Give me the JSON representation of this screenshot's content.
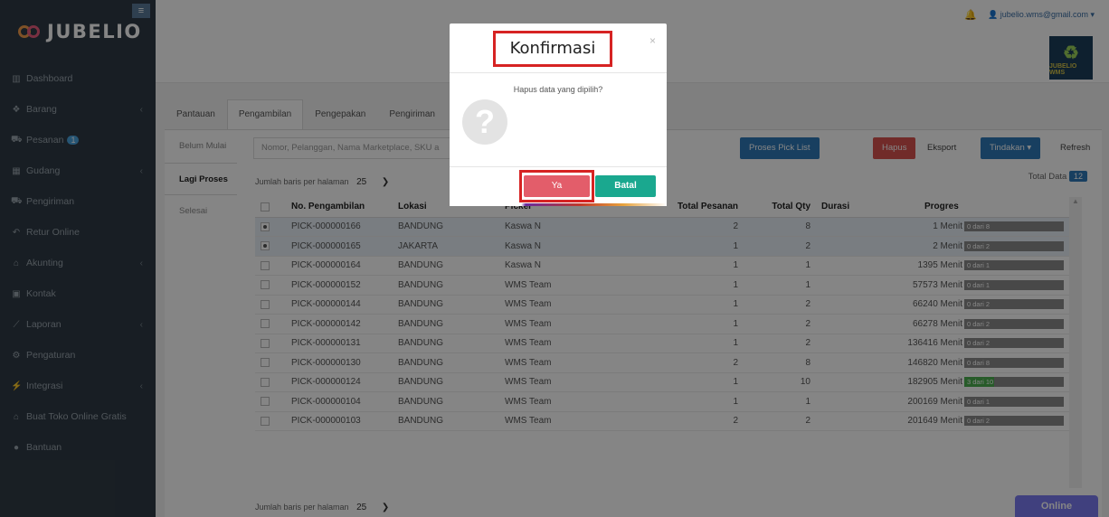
{
  "sidebar": {
    "brand": "JUBELIO",
    "menu_icon": "hamburger-icon",
    "items": [
      {
        "label": "Dashboard",
        "icon": "chart-icon",
        "chevron": false
      },
      {
        "label": "Barang",
        "icon": "box-icon",
        "chevron": true
      },
      {
        "label": "Pesanan",
        "icon": "cart-icon",
        "chevron": false,
        "badge": "1"
      },
      {
        "label": "Gudang",
        "icon": "building-icon",
        "chevron": true
      },
      {
        "label": "Pengiriman",
        "icon": "truck-icon",
        "chevron": false
      },
      {
        "label": "Retur Online",
        "icon": "reply-icon",
        "chevron": false
      },
      {
        "label": "Akunting",
        "icon": "bank-icon",
        "chevron": true
      },
      {
        "label": "Kontak",
        "icon": "id-card-icon",
        "chevron": false
      },
      {
        "label": "Laporan",
        "icon": "line-chart-icon",
        "chevron": true
      },
      {
        "label": "Pengaturan",
        "icon": "gears-icon",
        "chevron": false
      },
      {
        "label": "Integrasi",
        "icon": "plug-icon",
        "chevron": true
      },
      {
        "label": "Buat Toko Online Gratis",
        "icon": "store-icon",
        "chevron": false
      },
      {
        "label": "Bantuan",
        "icon": "help-icon",
        "chevron": false
      }
    ]
  },
  "topbar": {
    "user_email": "jubelio.wms@gmail.com",
    "wms_logo_text": "JUBELIO WMS"
  },
  "tabs": [
    "Pantauan",
    "Pengambilan",
    "Pengepakan",
    "Pengiriman"
  ],
  "active_tab": "Pengambilan",
  "subtabs": [
    "Belum Mulai",
    "Lagi Proses",
    "Selesai"
  ],
  "toolbar": {
    "search_placeholder": "Nomor, Pelanggan, Nama Marketplace, SKU a",
    "proses_pick_list": "Proses Pick List",
    "hapus": "Hapus",
    "eksport": "Eksport",
    "tindakan": "Tindakan ▾",
    "refresh": "Refresh",
    "rows_label": "Jumlah baris per halaman",
    "rows_value": "25",
    "total_label": "Total Data",
    "total_value": "12"
  },
  "table": {
    "headers": [
      "No. Pengambilan",
      "Lokasi",
      "Picker",
      "Total Pesanan",
      "Total Qty",
      "Durasi",
      "Progres"
    ],
    "rows": [
      {
        "no": "PICK-000000166",
        "lokasi": "BANDUNG",
        "picker": "Kaswa N",
        "pesanan": "2",
        "qty": "8",
        "durasi": "1 Menit",
        "progress_text": "0 dari 8",
        "progress": 0,
        "checked": true
      },
      {
        "no": "PICK-000000165",
        "lokasi": "JAKARTA",
        "picker": "Kaswa N",
        "pesanan": "1",
        "qty": "2",
        "durasi": "2 Menit",
        "progress_text": "0 dari 2",
        "progress": 0,
        "checked": true
      },
      {
        "no": "PICK-000000164",
        "lokasi": "BANDUNG",
        "picker": "Kaswa N",
        "pesanan": "1",
        "qty": "1",
        "durasi": "1395 Menit",
        "progress_text": "0 dari 1",
        "progress": 0,
        "checked": false
      },
      {
        "no": "PICK-000000152",
        "lokasi": "BANDUNG",
        "picker": "WMS Team",
        "pesanan": "1",
        "qty": "1",
        "durasi": "57573 Menit",
        "progress_text": "0 dari 1",
        "progress": 0,
        "checked": false
      },
      {
        "no": "PICK-000000144",
        "lokasi": "BANDUNG",
        "picker": "WMS Team",
        "pesanan": "1",
        "qty": "2",
        "durasi": "66240 Menit",
        "progress_text": "0 dari 2",
        "progress": 0,
        "checked": false
      },
      {
        "no": "PICK-000000142",
        "lokasi": "BANDUNG",
        "picker": "WMS Team",
        "pesanan": "1",
        "qty": "2",
        "durasi": "66278 Menit",
        "progress_text": "0 dari 2",
        "progress": 0,
        "checked": false
      },
      {
        "no": "PICK-000000131",
        "lokasi": "BANDUNG",
        "picker": "WMS Team",
        "pesanan": "1",
        "qty": "2",
        "durasi": "136416 Menit",
        "progress_text": "0 dari 2",
        "progress": 0,
        "checked": false
      },
      {
        "no": "PICK-000000130",
        "lokasi": "BANDUNG",
        "picker": "WMS Team",
        "pesanan": "2",
        "qty": "8",
        "durasi": "146820 Menit",
        "progress_text": "0 dari 8",
        "progress": 0,
        "checked": false
      },
      {
        "no": "PICK-000000124",
        "lokasi": "BANDUNG",
        "picker": "WMS Team",
        "pesanan": "1",
        "qty": "10",
        "durasi": "182905 Menit",
        "progress_text": "3 dari 10",
        "progress": 0.3,
        "checked": false
      },
      {
        "no": "PICK-000000104",
        "lokasi": "BANDUNG",
        "picker": "WMS Team",
        "pesanan": "1",
        "qty": "1",
        "durasi": "200169 Menit",
        "progress_text": "0 dari 1",
        "progress": 0,
        "checked": false
      },
      {
        "no": "PICK-000000103",
        "lokasi": "BANDUNG",
        "picker": "WMS Team",
        "pesanan": "2",
        "qty": "2",
        "durasi": "201649 Menit",
        "progress_text": "0 dari 2",
        "progress": 0,
        "checked": false
      }
    ]
  },
  "bottom": {
    "rows_label": "Jumlah baris per halaman",
    "rows_value": "25"
  },
  "online_label": "Online",
  "modal": {
    "title": "Konfirmasi",
    "message": "Hapus data yang dipilih?",
    "confirm": "Ya",
    "cancel": "Batal",
    "icon": "question-icon",
    "close_glyph": "×"
  },
  "colors": {
    "sidebar": "#2f3b45",
    "primary": "#2f7ab8",
    "danger": "#d9534f",
    "success": "#1aa88f",
    "highlight": "#d62323"
  }
}
